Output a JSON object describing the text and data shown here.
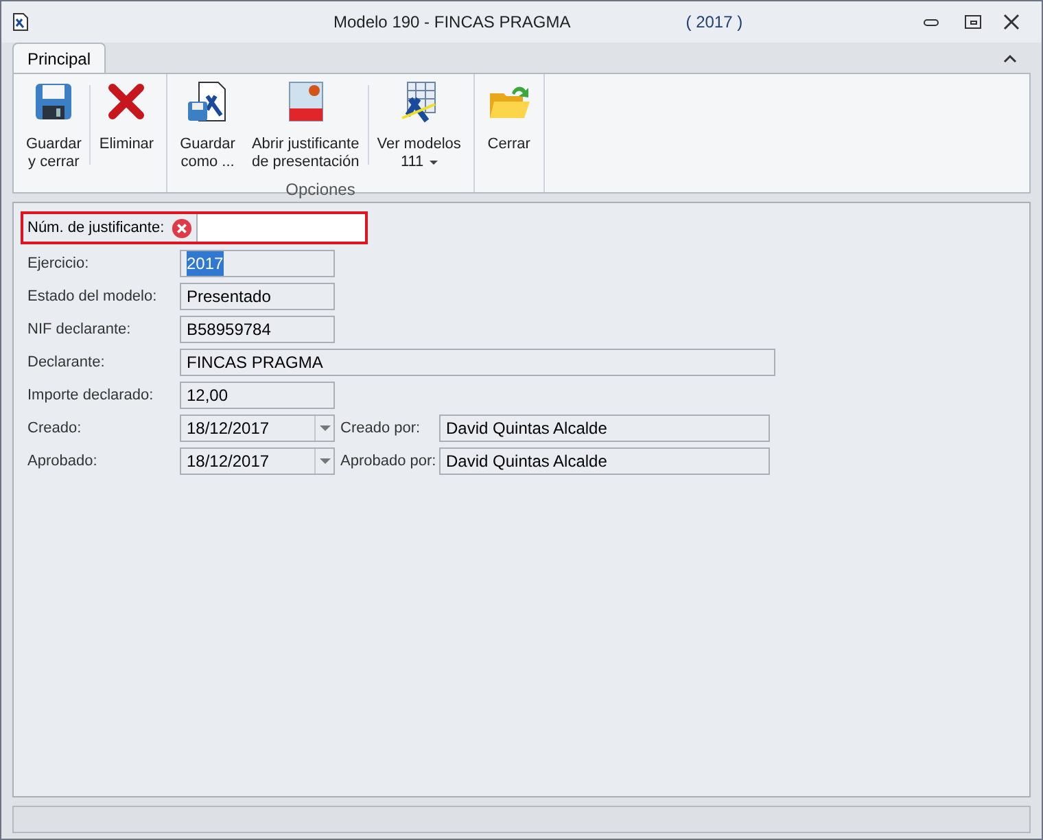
{
  "window": {
    "title": "Modelo 190 - FINCAS PRAGMA",
    "subtitle": "( 2017 )"
  },
  "tabs": [
    {
      "label": "Principal",
      "selected": true
    }
  ],
  "ribbon": {
    "groups": [
      {
        "buttons": [
          {
            "lines": [
              "Guardar",
              "y cerrar"
            ],
            "kind": "save"
          },
          {
            "lines": [
              "Eliminar"
            ],
            "kind": "delete"
          }
        ]
      },
      {
        "label": "Opciones",
        "buttons": [
          {
            "lines": [
              "Guardar",
              "como ..."
            ],
            "kind": "save-as"
          },
          {
            "lines": [
              "Abrir justificante",
              "de presentación"
            ],
            "kind": "pdf"
          },
          {
            "lines": [
              "Ver modelos",
              "111"
            ],
            "kind": "models",
            "menu": true
          }
        ]
      },
      {
        "buttons": [
          {
            "lines": [
              "Cerrar"
            ],
            "kind": "open-folder"
          }
        ]
      }
    ]
  },
  "fields": [
    {
      "kind": "text",
      "label": "Núm. de justificante:",
      "error": true
    },
    {
      "kind": "text",
      "label": "Ejercicio:",
      "value": "2017",
      "value_selected": true
    },
    {
      "kind": "text",
      "label": "Estado del modelo:",
      "value": "Presentado"
    },
    {
      "kind": "text",
      "label": "NIF declarante:",
      "value": "B58959784"
    },
    {
      "kind": "text",
      "label": "Declarante:",
      "value": "FINCAS PRAGMA",
      "wide": true
    },
    {
      "kind": "text",
      "label": "Importe declarado:",
      "value": "12,00"
    },
    {
      "kind": "date",
      "label": "Creado:",
      "value": "18/12/2017",
      "extra_label": "Creado por:",
      "extra_value": "David Quintas Alcalde"
    },
    {
      "kind": "date",
      "label": "Aprobado:",
      "value": "18/12/2017",
      "extra_label": "Aprobado por:",
      "extra_value": "David Quintas Alcalde"
    }
  ]
}
